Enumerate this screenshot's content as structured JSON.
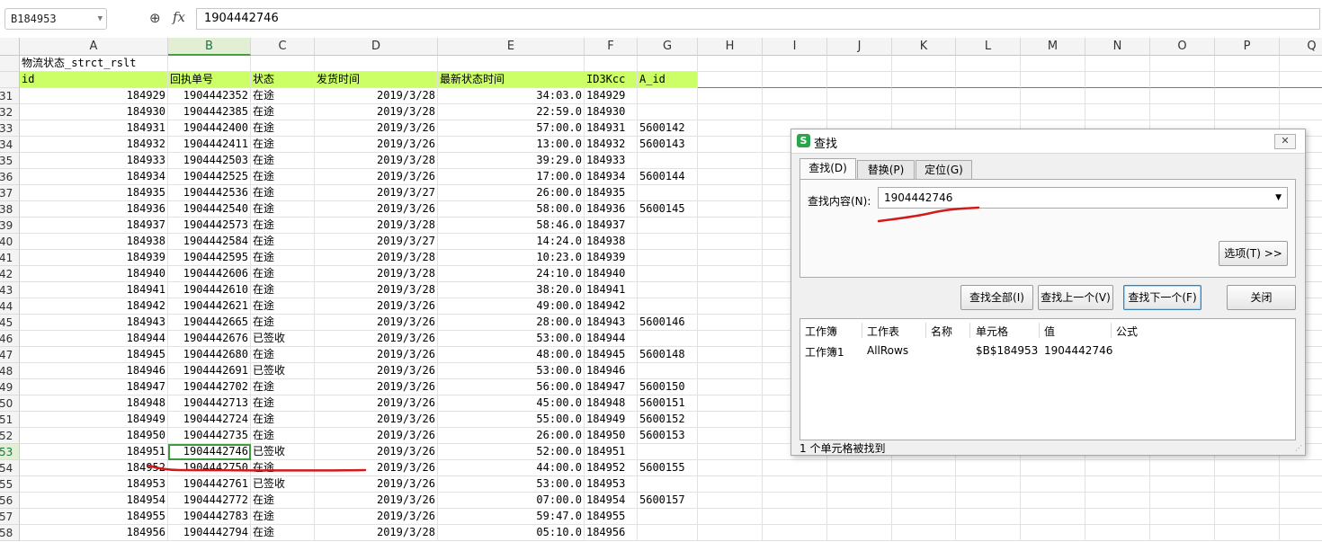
{
  "name_box": "B184953",
  "formula_value": "1904442746",
  "columns": [
    "A",
    "B",
    "C",
    "D",
    "E",
    "F",
    "G",
    "H",
    "I",
    "J",
    "K",
    "L",
    "M",
    "N",
    "O",
    "P",
    "Q"
  ],
  "selected_column": "B",
  "sheet_title": "物流状态_strct_rslt",
  "headers": [
    "id",
    "回执单号",
    "状态",
    "发货时间",
    "最新状态时间",
    "ID3Kcc",
    "A_id"
  ],
  "rows": [
    {
      "n": "31",
      "c": [
        "184929",
        "1904442352",
        "在途",
        "2019/3/28",
        "34:03.0",
        "184929",
        ""
      ]
    },
    {
      "n": "32",
      "c": [
        "184930",
        "1904442385",
        "在途",
        "2019/3/28",
        "22:59.0",
        "184930",
        ""
      ]
    },
    {
      "n": "33",
      "c": [
        "184931",
        "1904442400",
        "在途",
        "2019/3/26",
        "57:00.0",
        "184931",
        "5600142"
      ]
    },
    {
      "n": "34",
      "c": [
        "184932",
        "1904442411",
        "在途",
        "2019/3/26",
        "13:00.0",
        "184932",
        "5600143"
      ]
    },
    {
      "n": "35",
      "c": [
        "184933",
        "1904442503",
        "在途",
        "2019/3/28",
        "39:29.0",
        "184933",
        ""
      ]
    },
    {
      "n": "36",
      "c": [
        "184934",
        "1904442525",
        "在途",
        "2019/3/26",
        "17:00.0",
        "184934",
        "5600144"
      ]
    },
    {
      "n": "37",
      "c": [
        "184935",
        "1904442536",
        "在途",
        "2019/3/27",
        "26:00.0",
        "184935",
        ""
      ]
    },
    {
      "n": "38",
      "c": [
        "184936",
        "1904442540",
        "在途",
        "2019/3/26",
        "58:00.0",
        "184936",
        "5600145"
      ]
    },
    {
      "n": "39",
      "c": [
        "184937",
        "1904442573",
        "在途",
        "2019/3/28",
        "58:46.0",
        "184937",
        ""
      ]
    },
    {
      "n": "40",
      "c": [
        "184938",
        "1904442584",
        "在途",
        "2019/3/27",
        "14:24.0",
        "184938",
        ""
      ]
    },
    {
      "n": "41",
      "c": [
        "184939",
        "1904442595",
        "在途",
        "2019/3/28",
        "10:23.0",
        "184939",
        ""
      ]
    },
    {
      "n": "42",
      "c": [
        "184940",
        "1904442606",
        "在途",
        "2019/3/28",
        "24:10.0",
        "184940",
        ""
      ]
    },
    {
      "n": "43",
      "c": [
        "184941",
        "1904442610",
        "在途",
        "2019/3/28",
        "38:20.0",
        "184941",
        ""
      ]
    },
    {
      "n": "44",
      "c": [
        "184942",
        "1904442621",
        "在途",
        "2019/3/26",
        "49:00.0",
        "184942",
        ""
      ]
    },
    {
      "n": "45",
      "c": [
        "184943",
        "1904442665",
        "在途",
        "2019/3/26",
        "28:00.0",
        "184943",
        "5600146"
      ]
    },
    {
      "n": "46",
      "c": [
        "184944",
        "1904442676",
        "已签收",
        "2019/3/26",
        "53:00.0",
        "184944",
        ""
      ]
    },
    {
      "n": "47",
      "c": [
        "184945",
        "1904442680",
        "在途",
        "2019/3/26",
        "48:00.0",
        "184945",
        "5600148"
      ]
    },
    {
      "n": "48",
      "c": [
        "184946",
        "1904442691",
        "已签收",
        "2019/3/26",
        "53:00.0",
        "184946",
        ""
      ]
    },
    {
      "n": "49",
      "c": [
        "184947",
        "1904442702",
        "在途",
        "2019/3/26",
        "56:00.0",
        "184947",
        "5600150"
      ]
    },
    {
      "n": "50",
      "c": [
        "184948",
        "1904442713",
        "在途",
        "2019/3/26",
        "45:00.0",
        "184948",
        "5600151"
      ]
    },
    {
      "n": "51",
      "c": [
        "184949",
        "1904442724",
        "在途",
        "2019/3/26",
        "55:00.0",
        "184949",
        "5600152"
      ]
    },
    {
      "n": "52",
      "c": [
        "184950",
        "1904442735",
        "在途",
        "2019/3/26",
        "26:00.0",
        "184950",
        "5600153"
      ]
    },
    {
      "n": "53",
      "c": [
        "184951",
        "1904442746",
        "已签收",
        "2019/3/26",
        "52:00.0",
        "184951",
        ""
      ]
    },
    {
      "n": "54",
      "c": [
        "184952",
        "1904442750",
        "在途",
        "2019/3/26",
        "44:00.0",
        "184952",
        "5600155"
      ]
    },
    {
      "n": "55",
      "c": [
        "184953",
        "1904442761",
        "已签收",
        "2019/3/26",
        "53:00.0",
        "184953",
        ""
      ]
    },
    {
      "n": "56",
      "c": [
        "184954",
        "1904442772",
        "在途",
        "2019/3/26",
        "07:00.0",
        "184954",
        "5600157"
      ]
    },
    {
      "n": "57",
      "c": [
        "184955",
        "1904442783",
        "在途",
        "2019/3/26",
        "59:47.0",
        "184955",
        ""
      ]
    },
    {
      "n": "58",
      "c": [
        "184956",
        "1904442794",
        "在途",
        "2019/3/28",
        "05:10.0",
        "184956",
        ""
      ]
    }
  ],
  "selected_row": "53",
  "dialog": {
    "title": "查找",
    "icon_glyph": "S",
    "close_glyph": "✕",
    "tabs": [
      "查找(D)",
      "替换(P)",
      "定位(G)"
    ],
    "find_label": "查找内容(N):",
    "find_value": "1904442746",
    "options_button": "选项(T) >>",
    "buttons": [
      "查找全部(I)",
      "查找上一个(V)",
      "查找下一个(F)",
      "关闭"
    ],
    "result_headers": [
      "工作簿",
      "工作表",
      "名称",
      "单元格",
      "值",
      "公式"
    ],
    "result_row": [
      "工作簿1",
      "AllRows",
      "",
      "$B$184953",
      "1904442746",
      ""
    ],
    "status": "1 个单元格被找到"
  },
  "annotation_color": "#d11a1a"
}
